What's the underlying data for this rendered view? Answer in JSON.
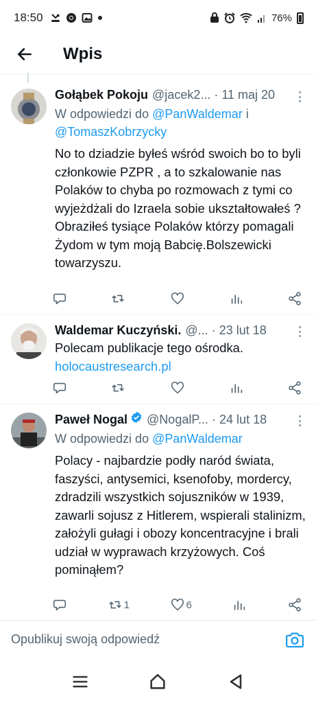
{
  "status_bar": {
    "time": "18:50",
    "battery": "76%",
    "left_icons": [
      "missed-call-icon",
      "chrome-icon",
      "gallery-icon",
      "dot-icon"
    ],
    "right_icons": [
      "lock-icon",
      "alarm-icon",
      "wifi-icon",
      "signal-icon",
      "battery-icon"
    ]
  },
  "header": {
    "title": "Wpis"
  },
  "tweets": [
    {
      "name": "Gołąbek Pokoju",
      "handle": "@jacek2...",
      "date": "11 maj 20",
      "reply_prefix": "W odpowiedzi do",
      "reply_users": [
        "@PanWaldemar",
        "@TomaszKobrzycky"
      ],
      "reply_conj": "i",
      "text": "No to dziadzie byłeś wśród swoich bo to byli członkowie PZPR , a to szkalowanie nas Polaków to chyba po rozmowach z tymi co wyjeżdżali do Izraela sobie ukształtowałeś ?\nObraziłeś tysiące Polaków którzy pomagali Żydom w tym moją Babcię.Bolszewicki towarzyszu.",
      "retweet_count": "",
      "like_count": ""
    },
    {
      "name": "Waldemar Kuczyński.",
      "handle": "@...",
      "date": "23 lut 18",
      "text": "Polecam publikacje tego ośrodka.",
      "link": "holocaustresearch.pl",
      "retweet_count": "",
      "like_count": ""
    },
    {
      "name": "Paweł Nogal",
      "handle": "@NogalP...",
      "date": "24 lut 18",
      "verified": true,
      "reply_prefix": "W odpowiedzi do",
      "reply_users": [
        "@PanWaldemar"
      ],
      "text": "Polacy - najbardzie podły naród świata, faszyści, antysemici, ksenofoby, mordercy, zdradzili wszystkich sojuszników w 1939, zawarli sojusz z Hitlerem, wspierali stalinizm, założyli gułagi i obozy koncentracyjne i brali udział w wyprawach krzyżowych. Coś pominąłem?",
      "retweet_count": "1",
      "like_count": "6"
    }
  ],
  "compose": {
    "placeholder": "Opublikuj swoją odpowiedź"
  },
  "colors": {
    "link": "#1d9bf0",
    "secondary_text": "#536471",
    "verified": "#1d9bf0"
  }
}
